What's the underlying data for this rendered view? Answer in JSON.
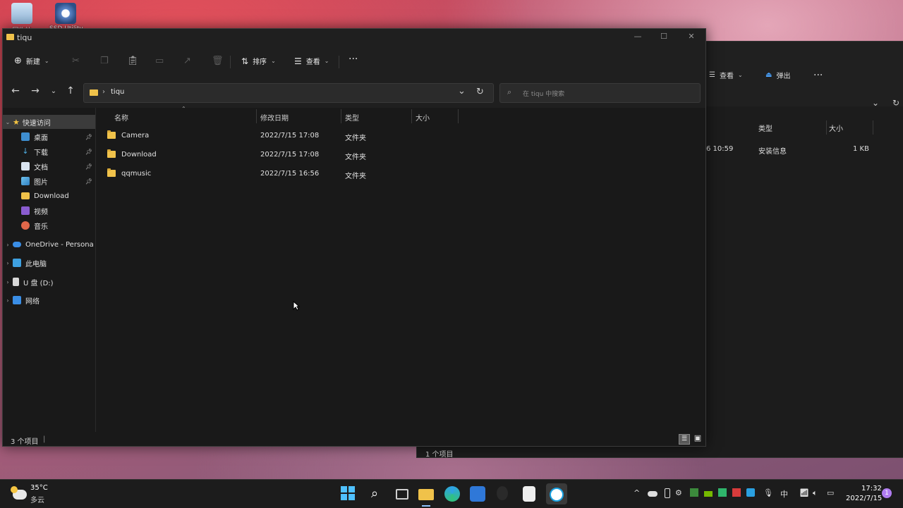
{
  "desktop": {
    "icons": [
      {
        "label": "回收站",
        "icon": "recycle-bin-icon"
      },
      {
        "label": "SSD Utility",
        "icon": "ssd-utility-icon"
      }
    ]
  },
  "back_window": {
    "toolbar": {
      "view_label": "查看",
      "eject_label": "弹出",
      "more": "···"
    },
    "headers": {
      "type": "类型",
      "size": "大小"
    },
    "row": {
      "date_partial": "6 10:59",
      "type": "安装信息",
      "size": "1 KB"
    },
    "status": "1 个项目"
  },
  "window": {
    "title": "tiqu",
    "toolbar": {
      "new_label": "新建",
      "sort_label": "排序",
      "view_label": "查看",
      "more": "···"
    },
    "address": {
      "path": "tiqu",
      "separator": "›"
    },
    "search": {
      "placeholder": "在 tiqu 中搜索"
    },
    "sidebar": {
      "quick_access": "快速访问",
      "items": [
        {
          "label": "桌面",
          "pinned": true
        },
        {
          "label": "下载",
          "pinned": true
        },
        {
          "label": "文档",
          "pinned": true
        },
        {
          "label": "图片",
          "pinned": true
        },
        {
          "label": "Download",
          "pinned": false
        },
        {
          "label": "视频",
          "pinned": false
        },
        {
          "label": "音乐",
          "pinned": false
        }
      ],
      "roots": [
        {
          "label": "OneDrive - Persona"
        },
        {
          "label": "此电脑"
        },
        {
          "label": "U 盘 (D:)"
        },
        {
          "label": "网络"
        }
      ]
    },
    "columns": {
      "name": "名称",
      "modified": "修改日期",
      "type": "类型",
      "size": "大小"
    },
    "files": [
      {
        "name": "Camera",
        "modified": "2022/7/15 17:08",
        "type": "文件夹"
      },
      {
        "name": "Download",
        "modified": "2022/7/15 17:08",
        "type": "文件夹"
      },
      {
        "name": "qqmusic",
        "modified": "2022/7/15 16:56",
        "type": "文件夹"
      }
    ],
    "status": "3 个项目"
  },
  "taskbar": {
    "weather": {
      "temp": "35°C",
      "desc": "多云"
    },
    "ime": "中",
    "time": "17:32",
    "date": "2022/7/15"
  }
}
